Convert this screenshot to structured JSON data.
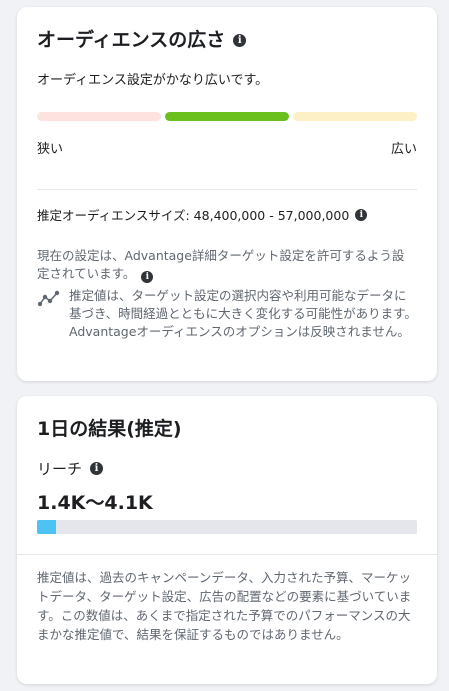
{
  "audience": {
    "title": "オーディエンスの広さ",
    "status": "オーディエンス設定がかなり広いです。",
    "meter": {
      "level_index": 1,
      "segment_colors": [
        "#fde2df",
        "#6bc01e",
        "#fdf0c7"
      ]
    },
    "label_narrow": "狭い",
    "label_wide": "広い",
    "size_label": "推定オーディエンスサイズ: 48,400,000 - 57,000,000",
    "advantage_note": "現在の設定は、Advantage詳細ターゲット設定を許可するよう設定されています。",
    "estimate_note": "推定値は、ターゲット設定の選択内容や利用可能なデータに基づき、時間経過とともに大きく変化する可能性があります。Advantageオーディエンスのオプションは反映されません。"
  },
  "daily": {
    "title": "1日の結果(推定)",
    "reach_label": "リーチ",
    "reach_value": "1.4K〜4.1K",
    "reach_bar_fraction": 0.05,
    "reach_bar_color": "#4cc3f0",
    "disclaimer": "推定値は、過去のキャンペーンデータ、入力された予算、マーケットデータ、ターゲット設定、広告の配置などの要素に基づいています。この数値は、あくまで指定された予算でのパフォーマンスの大まかな推定値で、結果を保証するものではありません。"
  },
  "icons": {
    "info": "info-icon",
    "trend": "trend-icon"
  }
}
